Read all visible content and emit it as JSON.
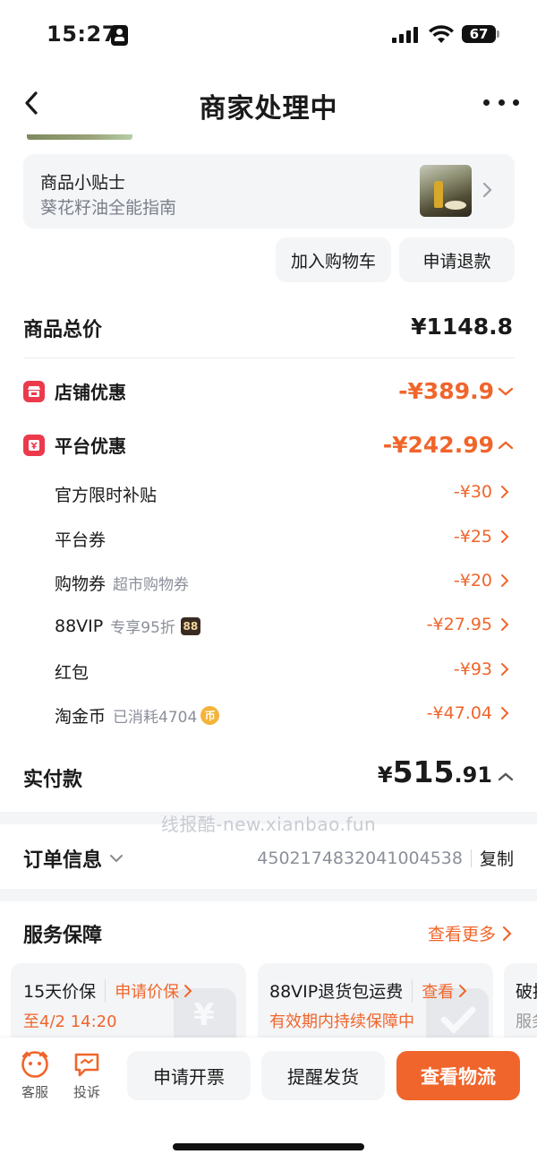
{
  "status_bar": {
    "time": "15:27",
    "battery": "67"
  },
  "nav": {
    "title": "商家处理中"
  },
  "tips": {
    "title": "商品小贴士",
    "subtitle": "葵花籽油全能指南"
  },
  "actions": {
    "add_cart": "加入购物车",
    "refund": "申请退款"
  },
  "price": {
    "total_label": "商品总价",
    "total_value": "¥1148.8",
    "shop_discount_label": "店铺优惠",
    "shop_discount_value": "-¥389.9",
    "platform_discount_label": "平台优惠",
    "platform_discount_value": "-¥242.99",
    "items": [
      {
        "label": "官方限时补贴",
        "note": "",
        "value": "-¥30"
      },
      {
        "label": "平台券",
        "note": "",
        "value": "-¥25"
      },
      {
        "label": "购物券",
        "note": "超市购物券",
        "value": "-¥20"
      },
      {
        "label": "88VIP",
        "note": "专享95折",
        "badge": "88",
        "value": "-¥27.95"
      },
      {
        "label": "红包",
        "note": "",
        "value": "-¥93"
      },
      {
        "label": "淘金币",
        "note": "已消耗4704",
        "badge": "币",
        "value": "-¥47.04"
      }
    ],
    "paid_label": "实付款",
    "paid_currency": "¥",
    "paid_int": "515",
    "paid_dec": ".91"
  },
  "watermark": "线报酷-new.xianbao.fun",
  "order": {
    "label": "订单信息",
    "number": "4502174832041004538",
    "copy": "复制"
  },
  "service": {
    "title": "服务保障",
    "more": "查看更多",
    "cards": [
      {
        "title": "15天价保",
        "link": "申请价保",
        "sub": "至4/2 14:20"
      },
      {
        "title": "88VIP退货包运费",
        "link": "查看",
        "sub": "有效期内持续保障中"
      },
      {
        "title": "破损",
        "link": "",
        "sub": "服务"
      }
    ]
  },
  "bottom_bar": {
    "service": "客服",
    "complain": "投诉",
    "invoice": "申请开票",
    "remind": "提醒发货",
    "logistics": "查看物流"
  },
  "colors": {
    "accent": "#f0652b",
    "red_icon": "#ec3a4c",
    "card_bg": "#f4f5f7"
  }
}
